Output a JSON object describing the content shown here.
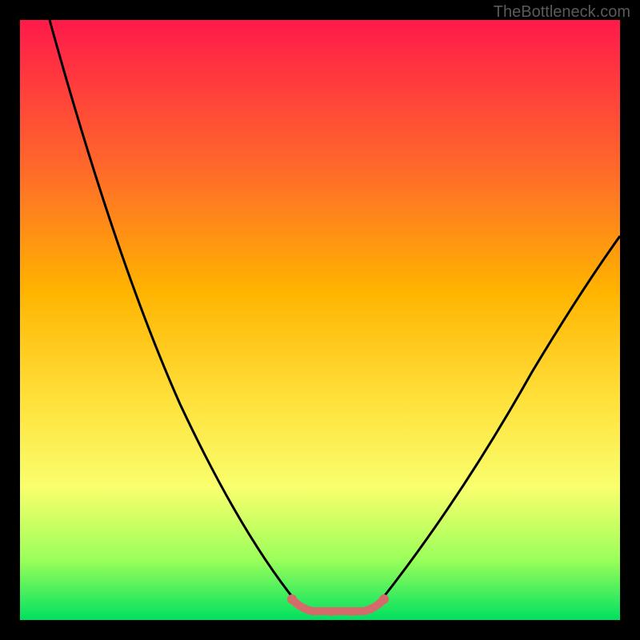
{
  "watermark": "TheBottleneck.com",
  "chart_data": {
    "type": "line",
    "title": "",
    "xlabel": "",
    "ylabel": "",
    "ylim": [
      0,
      100
    ],
    "xlim": [
      0,
      100
    ],
    "series": [
      {
        "name": "left-branch",
        "x": [
          5,
          10,
          15,
          20,
          25,
          30,
          35,
          40,
          46
        ],
        "values": [
          100,
          85,
          72,
          59,
          46,
          34,
          23,
          12,
          3
        ]
      },
      {
        "name": "right-branch",
        "x": [
          60,
          65,
          70,
          75,
          80,
          85,
          90,
          95,
          100
        ],
        "values": [
          3,
          10,
          19,
          28,
          36,
          44,
          51,
          58,
          64
        ]
      },
      {
        "name": "valley-highlight",
        "x": [
          46,
          48,
          51,
          55,
          58,
          60
        ],
        "values": [
          3,
          1,
          1,
          1,
          1,
          3
        ]
      }
    ],
    "colors": {
      "background_gradient": [
        "#ff1a4a",
        "#ff6a2a",
        "#ffb300",
        "#ffe03a",
        "#f9ff6d",
        "#9aff5a",
        "#00e060"
      ],
      "curve": "#000000",
      "highlight": "#d46a6a"
    },
    "notes": "No axes, ticks, or text labels are rendered in the figure. Values are proportional estimates (0-100) of the curve's vertical extent within the plot area."
  }
}
